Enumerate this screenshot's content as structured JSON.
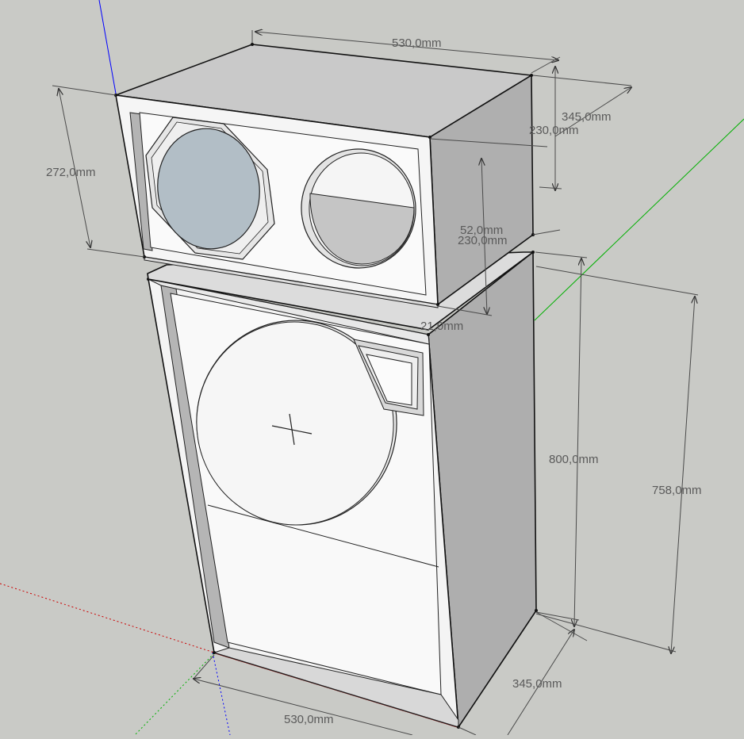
{
  "colors": {
    "background": "#c9cac6",
    "face_light": "#f7f7f7",
    "face_top": "#c8c8c8",
    "face_side": "#aeaeae",
    "port_interior": "#c4c4c4",
    "tweeter_blue": "#b2bec6",
    "axis_blue": "#0000ff",
    "axis_green": "#00b000",
    "axis_red": "#cc0000"
  },
  "icons": [
    "cross-center-mark-icon",
    "dimension-arrow-icon"
  ],
  "dimensions": {
    "top_width": "530,0mm",
    "top_depth": "345,0mm",
    "top_inner_depth": "230,0mm",
    "top_height": "272,0mm",
    "mid_overlap": "52,0mm",
    "mid_depth": "230,0mm",
    "panel_thickness": "21,0mm",
    "bottom_height_outer": "800,0mm",
    "bottom_height_inner": "758,0mm",
    "bottom_depth": "345,0mm",
    "bottom_width": "530,0mm"
  }
}
